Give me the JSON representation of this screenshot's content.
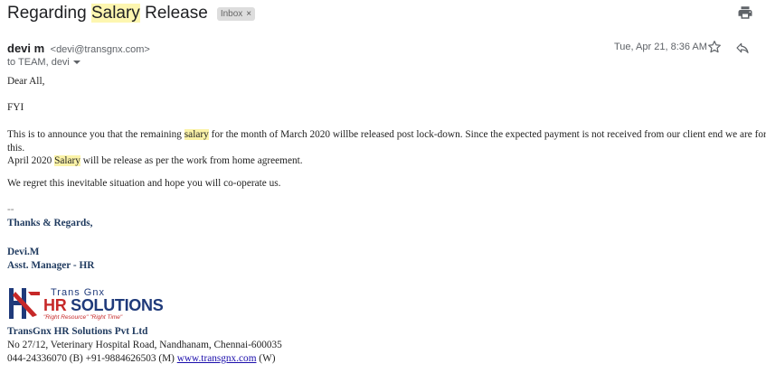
{
  "email": {
    "subject_before": "Regarding ",
    "subject_highlight": "Salary",
    "subject_after": " Release",
    "label": "Inbox",
    "label_close": "×",
    "sender_name": "devi m",
    "sender_email": "<devi@transgnx.com>",
    "recipients": "to TEAM, devi",
    "date": "Tue, Apr 21, 8:36 AM"
  },
  "icons": {
    "print": "print-icon",
    "star": "star-icon",
    "reply": "reply-icon",
    "expand": "chevron-down-icon"
  },
  "body": {
    "greeting": "Dear All,",
    "fyi": "FYI",
    "p1_before": "This is to announce you that the remaining ",
    "p1_highlight": "salary",
    "p1_after": " for the month of March 2020 willbe released post lock-down. Since the expected payment is not received from our client end we are force to do",
    "p1_cont": "this.",
    "p2_before": "April 2020 ",
    "p2_highlight": "Salary",
    "p2_after": " will be release as per the work from home agreement.",
    "p3": "We regret this inevitable situation and hope you will co-operate us."
  },
  "signature": {
    "dashes": "--",
    "closing": "Thanks & Regards,",
    "name": "Devi.M",
    "title": "Asst. Manager - HR",
    "logo_top": "Trans Gnx",
    "logo_hr": "HR",
    "logo_rest": " SOLUTIONS",
    "logo_tag": "\"Right Resource\" \"Right Time\"",
    "company": "TransGnx HR Solutions Pvt Ltd",
    "address": "No 27/12, Veterinary Hospital Road, Nandhanam, Chennai-600035",
    "phone_text": "044-24336070 (B)  +91-9884626503 (M)  ",
    "website": "www.transgnx.com",
    "website_suffix": " (W)"
  },
  "colors": {
    "highlight": "#fbf3a8",
    "signature_blue": "#1f3a5f",
    "logo_blue": "#1f3a7a",
    "logo_red": "#c62828",
    "link": "#1a0dab"
  }
}
